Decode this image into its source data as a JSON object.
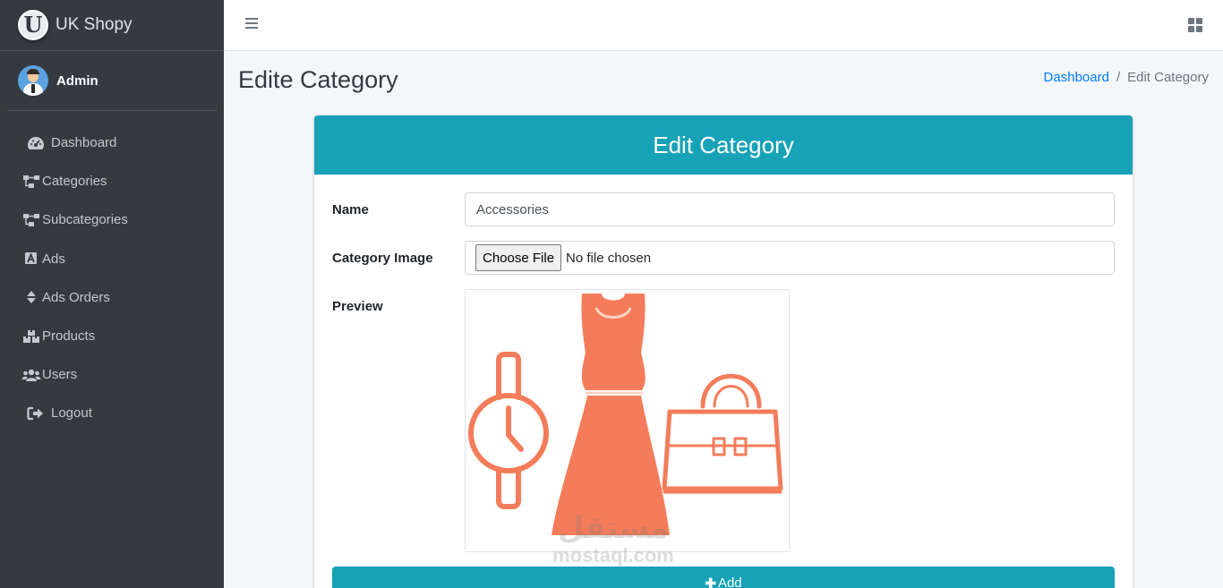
{
  "brand": {
    "name": "UK Shopy",
    "logo_letter": "U"
  },
  "user": {
    "name": "Admin"
  },
  "sidebar": {
    "items": [
      {
        "label": "Dashboard",
        "icon": "tachometer-icon"
      },
      {
        "label": "Categories",
        "icon": "sitemap-icon"
      },
      {
        "label": "Subcategories",
        "icon": "sitemap-icon"
      },
      {
        "label": "Ads",
        "icon": "ad-icon"
      },
      {
        "label": "Ads Orders",
        "icon": "sort-icon"
      },
      {
        "label": "Products",
        "icon": "boxes-icon"
      },
      {
        "label": "Users",
        "icon": "users-icon"
      },
      {
        "label": "Logout",
        "icon": "sign-out-icon"
      }
    ]
  },
  "header": {
    "title": "Edite Category",
    "breadcrumb": {
      "home": "Dashboard",
      "separator": "/",
      "current": "Edit Category"
    }
  },
  "form": {
    "title": "Edit Category",
    "name_label": "Name",
    "name_value": "Accessories",
    "image_label": "Category Image",
    "file_button": "Choose File",
    "file_status": "No file chosen",
    "preview_label": "Preview",
    "submit_label": "Add"
  },
  "watermark": {
    "arabic": "مستقل",
    "latin": "mostaql.com"
  },
  "colors": {
    "sidebar": "#343a40",
    "accent": "#17a2b8",
    "link": "#007bff",
    "preview_art": "#f47c5a"
  }
}
